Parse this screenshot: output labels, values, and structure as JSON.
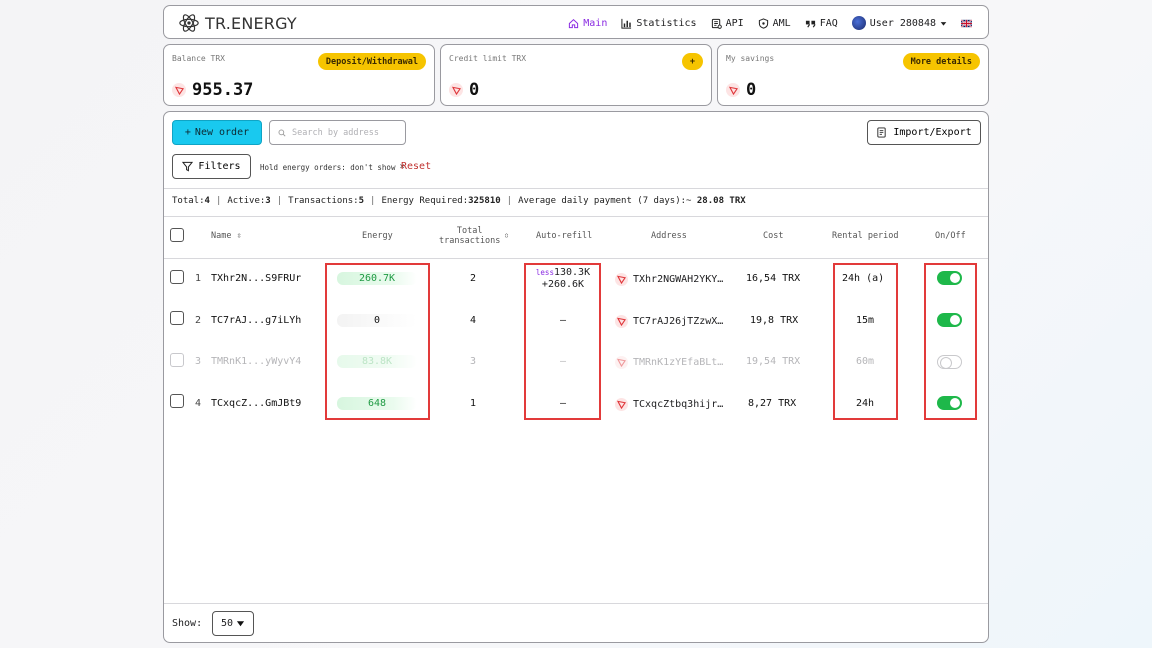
{
  "header": {
    "logo_text": "TR.ENERGY",
    "nav": [
      {
        "label": "Main",
        "icon": "home-icon",
        "active": true
      },
      {
        "label": "Statistics",
        "icon": "chart-icon"
      },
      {
        "label": "API",
        "icon": "api-icon"
      },
      {
        "label": "AML",
        "icon": "shield-icon"
      },
      {
        "label": "FAQ",
        "icon": "quote-icon"
      }
    ],
    "user_label": "User 280848",
    "language_icon": "uk-flag-icon"
  },
  "cards": {
    "balance": {
      "label": "Balance TRX",
      "button": "Deposit/Withdrawal",
      "value": "955.37"
    },
    "credit": {
      "label": "Credit limit TRX",
      "button": "+",
      "value": "0"
    },
    "savings": {
      "label": "My savings",
      "button": "More details",
      "value": "0"
    }
  },
  "toolbar": {
    "new_order": "New order",
    "search_placeholder": "Search by address",
    "import_export": "Import/Export",
    "filters": "Filters",
    "filter_chip": "Hold energy orders: don't show",
    "reset": "Reset"
  },
  "stats": {
    "total_label": "Total:",
    "total": "4",
    "active_label": "Active:",
    "active": "3",
    "transactions_label": "Transactions:",
    "transactions": "5",
    "energy_label": "Energy Required:",
    "energy": "325810",
    "avg_label": "Average daily payment (7 days):~",
    "avg": "28.08 TRX"
  },
  "table": {
    "headers": {
      "name": "Name",
      "energy": "Energy",
      "total_tx_1": "Total",
      "total_tx_2": "transactions",
      "autorefill": "Auto-refill",
      "address": "Address",
      "cost": "Cost",
      "rental": "Rental period",
      "onoff": "On/Off"
    },
    "rows": [
      {
        "num": "1",
        "name": "TXhr2N...S9FRUr",
        "energy": "260.7K",
        "energy_fraction": 0.7,
        "tx": "2",
        "autorefill_less": "less",
        "autorefill_1": "130.3K",
        "autorefill_2": "+260.6K",
        "address": "TXhr2NGWAH2YKY…",
        "cost": "16,54 TRX",
        "rental": "24h (a)",
        "on": true
      },
      {
        "num": "2",
        "name": "TC7rAJ...g7iLYh",
        "energy": "0",
        "energy_fraction": 0,
        "tx": "4",
        "autorefill": "—",
        "address": "TC7rAJ26jTZzwX…",
        "cost": "19,8 TRX",
        "rental": "15m",
        "on": true
      },
      {
        "num": "3",
        "name": "TMRnK1...yWyvY4",
        "energy": "83.8K",
        "energy_fraction": 0.7,
        "tx": "3",
        "autorefill": "—",
        "address": "TMRnK1zYEfaBLt…",
        "cost": "19,54 TRX",
        "rental": "60m",
        "on": false
      },
      {
        "num": "4",
        "name": "TCxqcZ...GmJBt9",
        "energy": "648",
        "energy_fraction": 0.7,
        "tx": "1",
        "autorefill": "—",
        "address": "TCxqcZtbq3hijr…",
        "cost": "8,27 TRX",
        "rental": "24h",
        "on": true
      }
    ]
  },
  "footer": {
    "show_label": "Show:",
    "page_size": "50"
  },
  "colors": {
    "accent": "#8a2be2",
    "new_order": "#19c9ef",
    "yellow": "#f6c400",
    "toggle_on": "#1eb84a",
    "highlight": "#e23a3a"
  }
}
